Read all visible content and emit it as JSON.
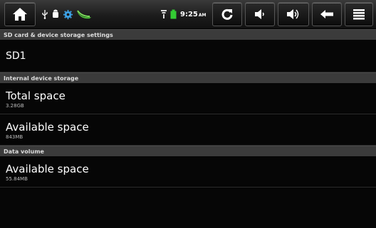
{
  "status_bar": {
    "clock_time": "9:25",
    "clock_ampm": "AM",
    "buttons": {
      "home": "home-icon",
      "sync": "sync-icon",
      "volume_down": "volume-down-icon",
      "volume_up": "volume-up-icon",
      "back": "back-arrow-icon",
      "menu": "menu-icon"
    },
    "notification_icons": [
      "usb-icon",
      "android-debug-icon",
      "settings-gear-icon",
      "app-icon"
    ],
    "battery_color": "#33cc33"
  },
  "screen": {
    "title": "SD card & device storage settings",
    "sd_card": {
      "title": "SD1"
    },
    "internal_storage": {
      "header": "Internal device storage",
      "total_space": {
        "title": "Total space",
        "value": "3.28GB"
      },
      "available_space": {
        "title": "Available space",
        "value": "843MB"
      }
    },
    "data_volume": {
      "header": "Data volume",
      "available_space": {
        "title": "Available space",
        "value": "55.84MB"
      }
    }
  }
}
